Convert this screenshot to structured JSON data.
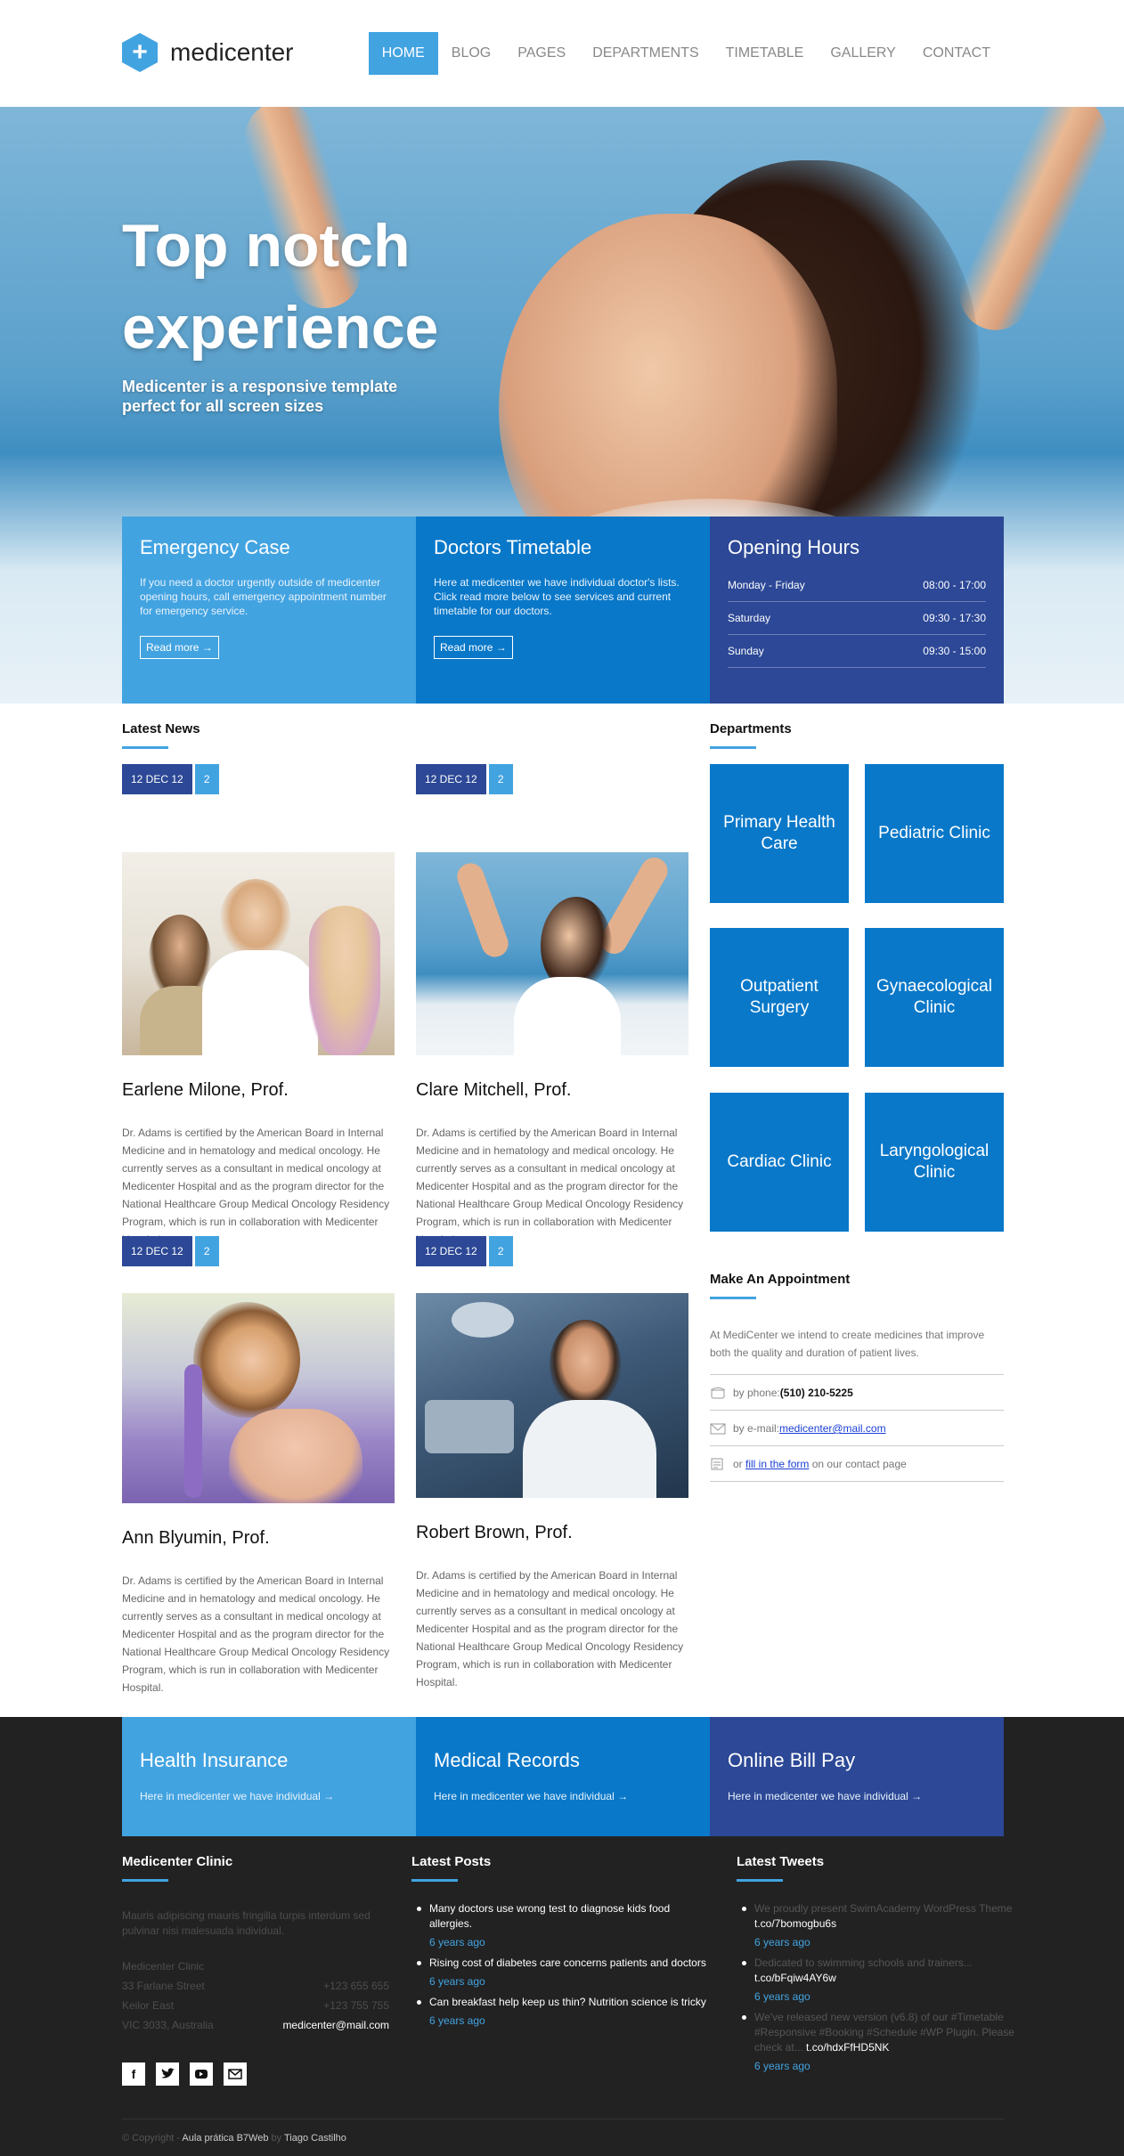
{
  "brand": {
    "name": "medicenter",
    "logo_icon": "plus-hexagon-icon"
  },
  "nav": [
    {
      "label": "HOME",
      "active": true
    },
    {
      "label": "BLOG"
    },
    {
      "label": "PAGES"
    },
    {
      "label": "DEPARTMENTS"
    },
    {
      "label": "TIMETABLE"
    },
    {
      "label": "GALLERY"
    },
    {
      "label": "CONTACT"
    }
  ],
  "hero": {
    "title": "Top notch experience",
    "subtitle": "Medicenter is a responsive template perfect for all screen sizes"
  },
  "features": {
    "emergency": {
      "title": "Emergency Case",
      "text": "If you need a doctor urgently outside of medicenter opening hours, call emergency appointment number for emergency service.",
      "button": "Read more →"
    },
    "timetable": {
      "title": "Doctors Timetable",
      "text": "Here at medicenter we have individual doctor's lists. Click read more below to see services and current timetable for our doctors.",
      "button": "Read more →"
    },
    "hours": {
      "title": "Opening Hours",
      "rows": [
        {
          "day": "Monday - Friday",
          "time": "08:00 - 17:00"
        },
        {
          "day": "Saturday",
          "time": "09:30 - 17:30"
        },
        {
          "day": "Sunday",
          "time": "09:30 - 15:00"
        }
      ]
    }
  },
  "news": {
    "title": "Latest News",
    "posts": [
      {
        "date": "12 DEC 12",
        "count": "2",
        "name": "Earlene Milone, Prof.",
        "text": "Dr. Adams is certified by the American Board in Internal Medicine and in hematology and medical oncology. He currently serves as a consultant in medical oncology at Medicenter Hospital and as the program director for the National Healthcare Group Medical Oncology Residency Program, which is run in collaboration with Medicenter Hospital."
      },
      {
        "date": "12 DEC 12",
        "count": "2",
        "name": "Clare Mitchell, Prof.",
        "text": "Dr. Adams is certified by the American Board in Internal Medicine and in hematology and medical oncology. He currently serves as a consultant in medical oncology at Medicenter Hospital and as the program director for the National Healthcare Group Medical Oncology Residency Program, which is run in collaboration with Medicenter Hospital."
      },
      {
        "date": "12 DEC 12",
        "count": "2",
        "name": "Ann Blyumin, Prof.",
        "text": "Dr. Adams is certified by the American Board in Internal Medicine and in hematology and medical oncology. He currently serves as a consultant in medical oncology at Medicenter Hospital and as the program director for the National Healthcare Group Medical Oncology Residency Program, which is run in collaboration with Medicenter Hospital."
      },
      {
        "date": "12 DEC 12",
        "count": "2",
        "name": "Robert Brown, Prof.",
        "text": "Dr. Adams is certified by the American Board in Internal Medicine and in hematology and medical oncology. He currently serves as a consultant in medical oncology at Medicenter Hospital and as the program director for the National Healthcare Group Medical Oncology Residency Program, which is run in collaboration with Medicenter Hospital."
      }
    ]
  },
  "departments": {
    "title": "Departments",
    "items": [
      "Primary Health Care",
      "Pediatric Clinic",
      "Outpatient Surgery",
      "Gynaecological Clinic",
      "Cardiac Clinic",
      "Laryngological Clinic"
    ]
  },
  "appointment": {
    "title": "Make An Appointment",
    "intro": "At MediCenter we intend to create medicines that improve both the quality and duration of patient lives.",
    "phone_label": "by phone:",
    "phone": "(510) 210-5225",
    "email_label": "by e-mail:",
    "email": "medicenter@mail.com",
    "form_prefix": "or",
    "form_link": "fill in the form",
    "form_suffix": "on our contact page"
  },
  "footer_boxes": [
    {
      "title": "Health Insurance",
      "text": "Here in medicenter we have individual →"
    },
    {
      "title": "Medical Records",
      "text": "Here in medicenter we have individual →"
    },
    {
      "title": "Online Bill Pay",
      "text": "Here in medicenter we have individual →"
    }
  ],
  "footer": {
    "clinic": {
      "title": "Medicenter Clinic",
      "text": "Mauris adipiscing mauris fringilla turpis interdum sed pulvinar nisi malesuada individual.",
      "address": [
        {
          "left": "Medicenter Clinic",
          "right": ""
        },
        {
          "left": "33 Farlane Street",
          "right": "+123 655 655"
        },
        {
          "left": "Keilor East",
          "right": "+123 755 755"
        },
        {
          "left": "VIC 3033, Australia",
          "right": "medicenter@mail.com"
        }
      ]
    },
    "posts": {
      "title": "Latest Posts",
      "items": [
        {
          "text": "Many doctors use wrong test to diagnose kids food allergies.",
          "ago": "6 years ago"
        },
        {
          "text": "Rising cost of diabetes care concerns patients and doctors",
          "ago": "6 years ago"
        },
        {
          "text": "Can breakfast help keep us thin? Nutrition science is tricky",
          "ago": "6 years ago"
        }
      ]
    },
    "tweets": {
      "title": "Latest Tweets",
      "items": [
        {
          "text": "We proudly present SwimAcademy WordPress Theme",
          "link": "t.co/7bomogbu6s",
          "ago": "6 years ago"
        },
        {
          "text": "Dedicated to swimming schools and trainers...",
          "link": "t.co/bFqiw4AY6w",
          "ago": "6 years ago"
        },
        {
          "text": "We've released new version (v6.8) of our #Timetable #Responsive #Booking #Schedule #WP Plugin. Please check at...",
          "link": "t.co/hdxFfHD5NK",
          "ago": "6 years ago"
        }
      ]
    },
    "social": [
      "facebook-icon",
      "twitter-icon",
      "youtube-icon",
      "mail-icon"
    ],
    "copyright": {
      "prefix": "© Copyright -",
      "site": "Aula prática B7Web",
      "by": "by",
      "author": "Tiago Castilho"
    }
  },
  "colors": {
    "accent": "#42a3e1",
    "mid": "#0978c9",
    "dark": "#2c4896",
    "footer": "#222222"
  }
}
